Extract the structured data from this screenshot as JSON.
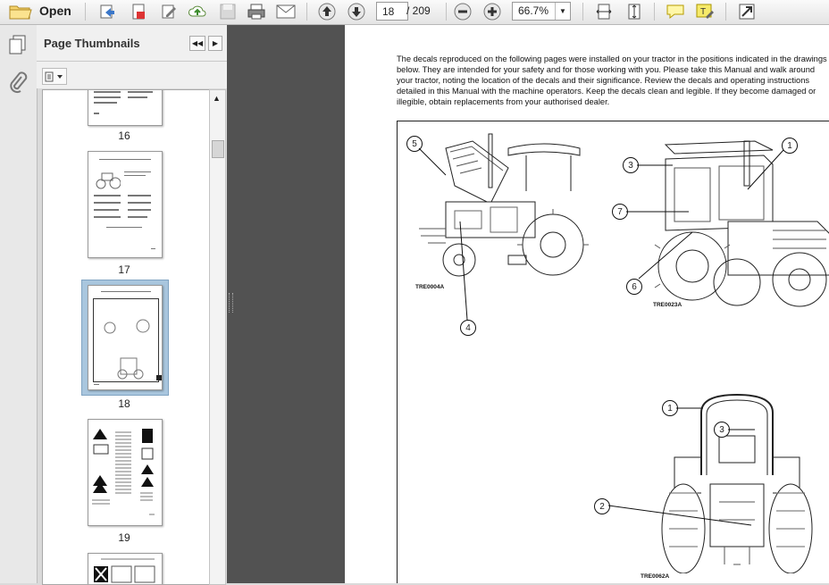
{
  "toolbar": {
    "open_label": "Open",
    "current_page": "18",
    "page_total": "/ 209",
    "zoom_value": "66.7%"
  },
  "panel": {
    "title": "Page Thumbnails"
  },
  "thumbnails": [
    {
      "page": "16"
    },
    {
      "page": "17"
    },
    {
      "page": "18",
      "selected": true
    },
    {
      "page": "19"
    }
  ],
  "document": {
    "intro_lines": [
      "The decals reproduced on the following pages were installed on your tractor in the positions indicated in the drawings",
      "below. They are intended for your safety and for those working with you. Please take this Manual and walk around",
      "your tractor, noting the location of the decals and their significance. Review the decals and operating instructions",
      "detailed in this Manual with the machine operators. Keep the decals clean and legible. If they become damaged or",
      "illegible, obtain replacements from your authorised dealer."
    ],
    "figures": {
      "fig1_label": "TRE0004A",
      "fig2_label": "TRE0023A",
      "fig3_label": "TRE0062A"
    },
    "callouts": {
      "c5": "5",
      "c4": "4",
      "c1a": "1",
      "c3a": "3",
      "c7": "7",
      "c6": "6",
      "c1b": "1",
      "c3b": "3",
      "c2": "2"
    }
  }
}
